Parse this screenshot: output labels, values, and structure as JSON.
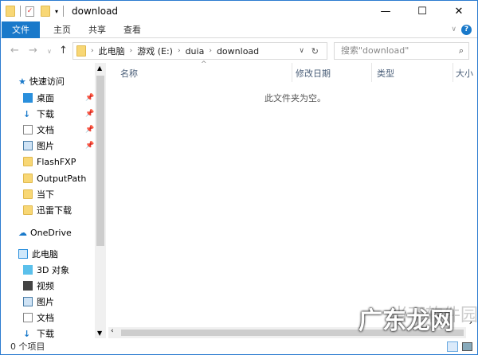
{
  "title": "download",
  "ribbon": {
    "tabs": [
      "文件",
      "主页",
      "共享",
      "查看"
    ]
  },
  "address": {
    "crumbs": [
      "此电脑",
      "游戏 (E:)",
      "duia",
      "download"
    ]
  },
  "search": {
    "placeholder": "搜索\"download\""
  },
  "nav": {
    "quick_access": "快速访问",
    "items": [
      "桌面",
      "下载",
      "文档",
      "图片",
      "FlashFXP",
      "OutputPath",
      "当下",
      "迅雷下载"
    ],
    "onedrive": "OneDrive",
    "this_pc": "此电脑",
    "pc_items": [
      "3D 对象",
      "视频",
      "图片",
      "文档",
      "下载"
    ]
  },
  "columns": [
    "名称",
    "修改日期",
    "类型",
    "大小"
  ],
  "empty_message": "此文件夹为空。",
  "status": "0 个项目",
  "watermark": {
    "text": "广东龙网",
    "sub": "当下软件园"
  }
}
